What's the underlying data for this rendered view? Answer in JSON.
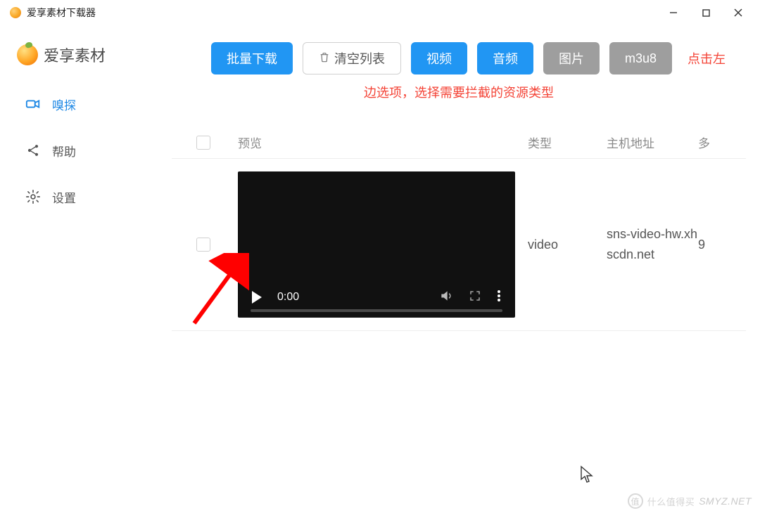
{
  "app": {
    "title": "爱享素材下载器"
  },
  "brand": {
    "label": "爱享素材"
  },
  "sidebar": {
    "items": [
      {
        "label": "嗅探",
        "icon": "video-cam-icon",
        "active": true
      },
      {
        "label": "帮助",
        "icon": "share-icon",
        "active": false
      },
      {
        "label": "设置",
        "icon": "gear-icon",
        "active": false
      }
    ]
  },
  "toolbar": {
    "download": "批量下载",
    "clear": "清空列表",
    "video": "视频",
    "audio": "音频",
    "image": "图片",
    "m3u8": "m3u8"
  },
  "hint": {
    "part1": "点击左",
    "part2": "边选项，选择需要拦截的资源类型"
  },
  "table": {
    "headers": {
      "preview": "预览",
      "type": "类型",
      "host": "主机地址",
      "more": "多"
    },
    "rows": [
      {
        "type": "video",
        "host": "sns-video-hw.xhscdn.net",
        "more": "9",
        "video_time": "0:00"
      }
    ]
  },
  "watermark": {
    "cn": "什么值得买",
    "en": "SMYZ.NET",
    "badge": "值"
  }
}
